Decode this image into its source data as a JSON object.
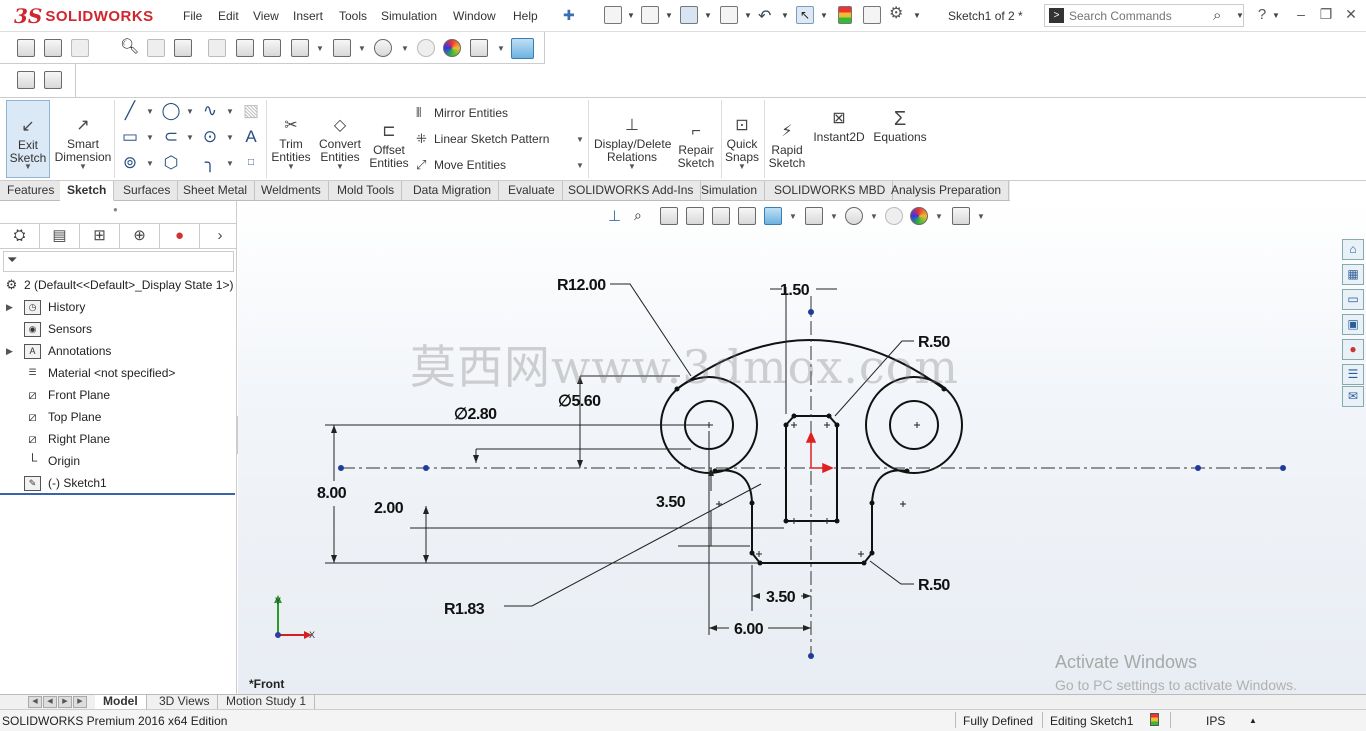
{
  "app": {
    "logo_prefix": "3S",
    "logo_text": "SOLIDWORKS",
    "document_title": "Sketch1 of 2 *"
  },
  "menu": [
    "File",
    "Edit",
    "View",
    "Insert",
    "Tools",
    "Simulation",
    "Window",
    "Help"
  ],
  "search": {
    "placeholder": "Search Commands"
  },
  "command_manager": {
    "exit_sketch": "Exit\nSketch",
    "smart_dimension": "Smart\nDimension",
    "trim_entities": "Trim\nEntities",
    "convert_entities": "Convert\nEntities",
    "offset_entities": "Offset\nEntities",
    "mirror_entities": "Mirror Entities",
    "linear_sketch_pattern": "Linear Sketch Pattern",
    "move_entities": "Move Entities",
    "display_delete_relations": "Display/Delete\nRelations",
    "repair_sketch": "Repair\nSketch",
    "quick_snaps": "Quick\nSnaps",
    "rapid_sketch": "Rapid\nSketch",
    "instant2d": "Instant2D",
    "equations": "Equations"
  },
  "tabs": [
    "Features",
    "Sketch",
    "Surfaces",
    "Sheet Metal",
    "Weldments",
    "Mold Tools",
    "Data Migration",
    "Evaluate",
    "SOLIDWORKS Add-Ins",
    "Simulation",
    "SOLIDWORKS MBD",
    "Analysis Preparation"
  ],
  "active_tab": "Sketch",
  "feature_tree": {
    "root": "2  (Default<<Default>_Display State 1>)",
    "items": [
      "History",
      "Sensors",
      "Annotations",
      "Material <not specified>",
      "Front Plane",
      "Top Plane",
      "Right Plane",
      "Origin",
      "(-) Sketch1"
    ]
  },
  "graphics": {
    "view_name": "*Front",
    "watermark": "莫西网www.3dmox.com",
    "activate_title": "Activate Windows",
    "activate_subtitle": "Go to PC settings to activate Windows.",
    "triad_y": "Y",
    "triad_x": "X"
  },
  "dimensions": {
    "r_big": "R12.00",
    "width_top": "1.50",
    "r_small_top": "R.50",
    "dia_small": "∅2.80",
    "dia_large": "∅5.60",
    "height_total": "8.00",
    "height_step": "2.00",
    "gap_mid": "3.50",
    "r_fillet": "R1.83",
    "width_bottom": "3.50",
    "width_half": "6.00",
    "r_small_bottom": "R.50"
  },
  "model_tabs": [
    "Model",
    "3D Views",
    "Motion Study 1"
  ],
  "active_model_tab": "Model",
  "status": {
    "edition": "SOLIDWORKS Premium 2016 x64 Edition",
    "defined": "Fully Defined",
    "editing": "Editing Sketch1",
    "units": "IPS"
  },
  "colors": {
    "brand_red": "#d0262d",
    "selection_blue": "#1f3b9c",
    "sketch_black": "#111111",
    "origin_red": "#e02020"
  }
}
